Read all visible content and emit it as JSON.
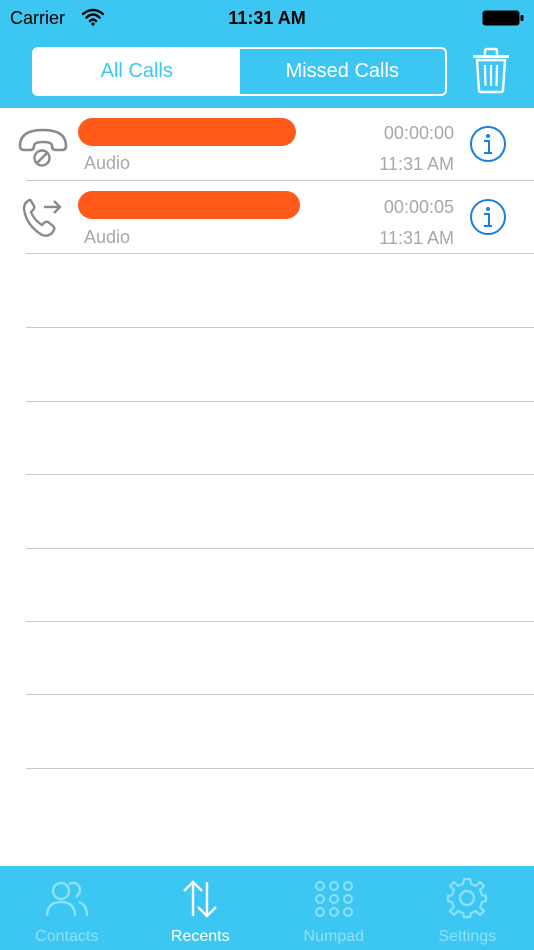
{
  "status_bar": {
    "carrier": "Carrier",
    "time": "11:31 AM"
  },
  "segmented": {
    "all_calls": "All Calls",
    "missed_calls": "Missed Calls",
    "selected": "All Calls"
  },
  "header": {
    "trash_icon": "trash-icon"
  },
  "calls": [
    {
      "icon": "missed-call-icon",
      "type": "Audio",
      "duration": "00:00:00",
      "time": "11:31 AM"
    },
    {
      "icon": "outgoing-call-icon",
      "type": "Audio",
      "duration": "00:00:05",
      "time": "11:31 AM"
    }
  ],
  "tabbar": {
    "tabs": [
      {
        "label": "Contacts",
        "icon": "contacts-icon"
      },
      {
        "label": "Recents",
        "icon": "recents-icon"
      },
      {
        "label": "Numpad",
        "icon": "numpad-icon"
      },
      {
        "label": "Settings",
        "icon": "settings-icon"
      }
    ],
    "active": "Recents"
  },
  "colors": {
    "accent": "#3cc6f2",
    "redaction": "#ff5a1a",
    "info_blue": "#1a7fe0",
    "secondary_text": "#a8a8a8"
  }
}
